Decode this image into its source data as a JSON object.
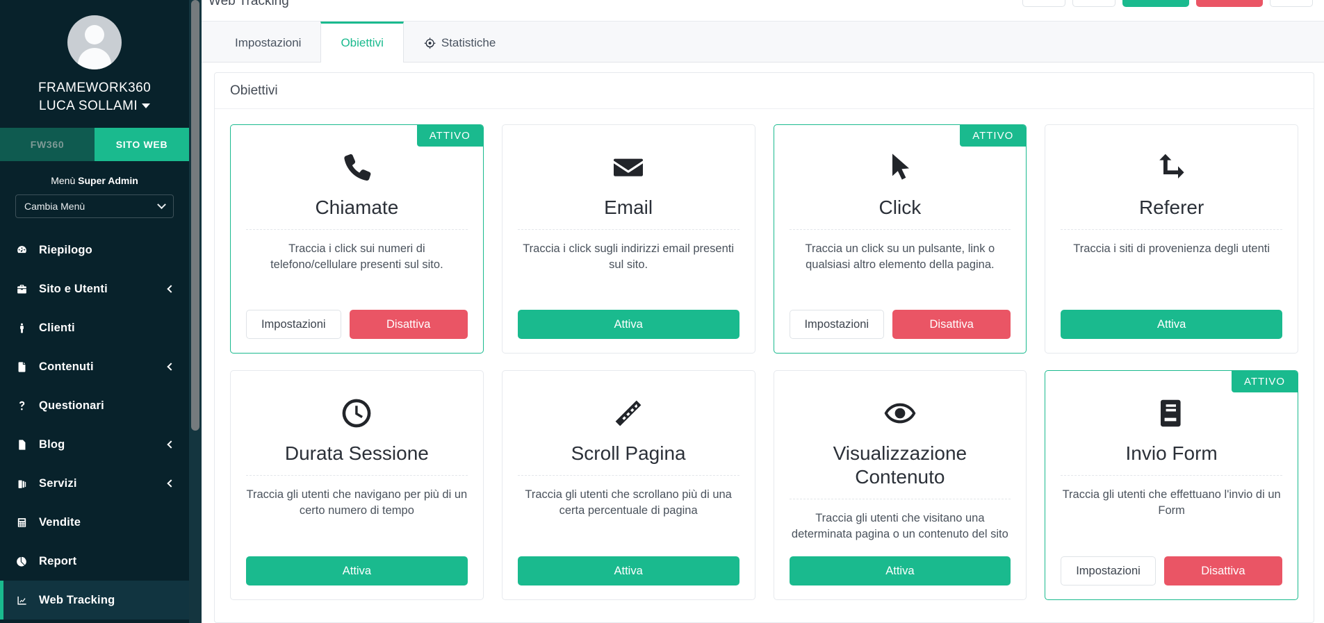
{
  "sidebar": {
    "org_name": "FRAMEWORK360",
    "user_name": "LUCA SOLLAMI",
    "segmented": {
      "left_label": "FW360",
      "right_label": "SITO WEB"
    },
    "menu_switch": {
      "label_prefix": "Menù ",
      "label_strong": "Super Admin",
      "select_value": "Cambia Menù"
    },
    "items": [
      {
        "label": "Riepilogo",
        "icon": "gauge-icon",
        "has_arrow": false,
        "active": false
      },
      {
        "label": "Sito e Utenti",
        "icon": "briefcase-icon",
        "has_arrow": true,
        "active": false
      },
      {
        "label": "Clienti",
        "icon": "person-icon",
        "has_arrow": false,
        "active": false
      },
      {
        "label": "Contenuti",
        "icon": "file-icon",
        "has_arrow": true,
        "active": false
      },
      {
        "label": "Questionari",
        "icon": "question-icon",
        "has_arrow": false,
        "active": false
      },
      {
        "label": "Blog",
        "icon": "document-icon",
        "has_arrow": true,
        "active": false
      },
      {
        "label": "Servizi",
        "icon": "suitcase-icon",
        "has_arrow": true,
        "active": false
      },
      {
        "label": "Vendite",
        "icon": "calculator-icon",
        "has_arrow": false,
        "active": false
      },
      {
        "label": "Report",
        "icon": "pie-chart-icon",
        "has_arrow": false,
        "active": false
      },
      {
        "label": "Web Tracking",
        "icon": "line-chart-icon",
        "has_arrow": false,
        "active": true
      }
    ]
  },
  "header": {
    "breadcrumb": "Web Tracking"
  },
  "tabs": [
    {
      "label": "Impostazioni",
      "icon": null,
      "active": false
    },
    {
      "label": "Obiettivi",
      "icon": null,
      "active": true
    },
    {
      "label": "Statistiche",
      "icon": "target-icon",
      "active": false
    }
  ],
  "panel": {
    "title": "Obiettivi"
  },
  "cards": [
    {
      "title": "Chiamate",
      "icon": "phone-icon",
      "description": "Traccia i click sui numeri di telefono/cellulare presenti sul sito.",
      "status_badge": "ATTIVO",
      "active": true,
      "buttons": [
        {
          "label": "Impostazioni",
          "style": "settings"
        },
        {
          "label": "Disattiva",
          "style": "deactivate"
        }
      ]
    },
    {
      "title": "Email",
      "icon": "envelope-icon",
      "description": "Traccia i click sugli indirizzi email presenti sul sito.",
      "status_badge": null,
      "active": false,
      "buttons": [
        {
          "label": "Attiva",
          "style": "activate"
        }
      ]
    },
    {
      "title": "Click",
      "icon": "cursor-icon",
      "description": "Traccia un click su un pulsante, link o qualsiasi altro elemento della pagina.",
      "status_badge": "ATTIVO",
      "active": true,
      "buttons": [
        {
          "label": "Impostazioni",
          "style": "settings"
        },
        {
          "label": "Disattiva",
          "style": "deactivate"
        }
      ]
    },
    {
      "title": "Referer",
      "icon": "retweet-icon",
      "description": "Traccia i siti di provenienza degli utenti",
      "status_badge": null,
      "active": false,
      "buttons": [
        {
          "label": "Attiva",
          "style": "activate"
        }
      ]
    },
    {
      "title": "Durata Sessione",
      "icon": "clock-icon",
      "description": "Traccia gli utenti che navigano per più di un certo numero di tempo",
      "status_badge": null,
      "active": false,
      "buttons": [
        {
          "label": "Attiva",
          "style": "activate"
        }
      ]
    },
    {
      "title": "Scroll Pagina",
      "icon": "ruler-icon",
      "description": "Traccia gli utenti che scrollano più di una certa percentuale di pagina",
      "status_badge": null,
      "active": false,
      "buttons": [
        {
          "label": "Attiva",
          "style": "activate"
        }
      ]
    },
    {
      "title": "Visualizzazione Contenuto",
      "icon": "eye-icon",
      "description": "Traccia gli utenti che visitano una determinata pagina o un contenuto del sito",
      "status_badge": null,
      "active": false,
      "buttons": [
        {
          "label": "Attiva",
          "style": "activate"
        }
      ]
    },
    {
      "title": "Invio Form",
      "icon": "book-icon",
      "description": "Traccia gli utenti che effettuano l'invio di un Form",
      "status_badge": "ATTIVO",
      "active": true,
      "buttons": [
        {
          "label": "Impostazioni",
          "style": "settings"
        },
        {
          "label": "Disattiva",
          "style": "deactivate"
        }
      ]
    }
  ],
  "colors": {
    "sidebar_bg": "#08222b",
    "accent_green": "#1aba8e",
    "danger_red": "#ea5565",
    "seg_inactive": "#0f5b50"
  }
}
